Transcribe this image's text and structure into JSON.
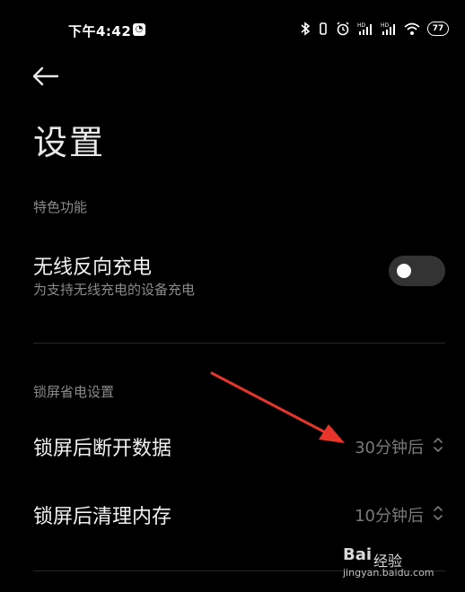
{
  "status_bar": {
    "time": "下午4:42",
    "battery": "77",
    "icons": [
      "bluetooth-icon",
      "vibrate-icon",
      "alarm-icon",
      "signal-hd-icon",
      "signal-hd-icon",
      "wifi-icon",
      "battery-icon"
    ]
  },
  "header": {
    "back_icon": "arrow-left-icon",
    "title": "设置"
  },
  "sections": [
    {
      "header": "特色功能",
      "items": [
        {
          "title": "无线反向充电",
          "subtitle": "为支持无线充电的设备充电",
          "control": "toggle",
          "enabled": false
        }
      ]
    },
    {
      "header": "锁屏省电设置",
      "items": [
        {
          "title": "锁屏后断开数据",
          "value": "30分钟后",
          "control": "dropdown"
        },
        {
          "title": "锁屏后清理内存",
          "value": "10分钟后",
          "control": "dropdown"
        }
      ]
    }
  ],
  "annotation": {
    "type": "red-arrow",
    "color": "#e8352b"
  },
  "watermark": {
    "logo": "Bai",
    "text": "经验",
    "url": "jingyan.baidu.com"
  },
  "colors": {
    "background": "#000000",
    "primary_text": "#f2f2f2",
    "secondary_text": "#8a8a8a",
    "toggle_off": "#333333"
  }
}
